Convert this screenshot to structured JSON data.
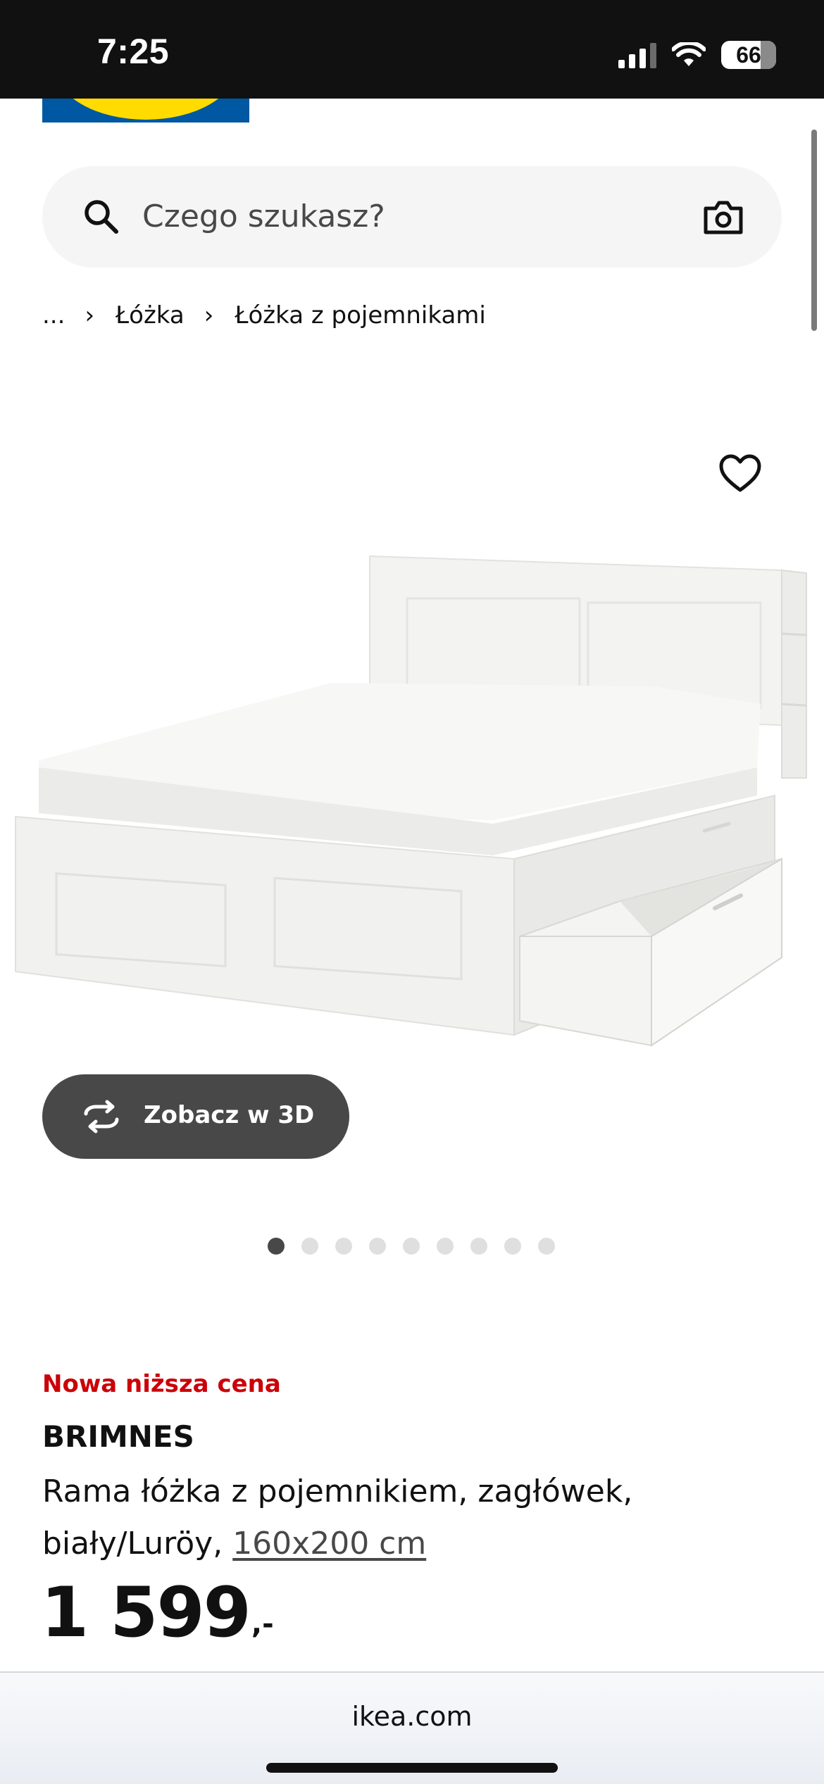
{
  "status_bar": {
    "time": "7:25",
    "battery": "66"
  },
  "search": {
    "placeholder": "Czego szukasz?"
  },
  "breadcrumb": {
    "items": [
      "...",
      "Łóżka",
      "Łóżka z pojemnikami"
    ]
  },
  "view3d": {
    "label": "Zobacz w 3D"
  },
  "carousel": {
    "dot_count": 9,
    "active_index": 0
  },
  "product": {
    "promo": "Nowa niższa cena",
    "name": "BRIMNES",
    "description": "Rama łóżka z pojemnikiem, zagłówek, biały/Luröy,",
    "size": "160x200 cm",
    "price_int": "1 599",
    "price_dec": ",-"
  },
  "browser": {
    "url": "ikea.com"
  },
  "colors": {
    "promo_red": "#cc0008",
    "ikea_blue": "#0058a3",
    "ikea_yellow": "#ffdb00",
    "button_dark": "#484848"
  }
}
